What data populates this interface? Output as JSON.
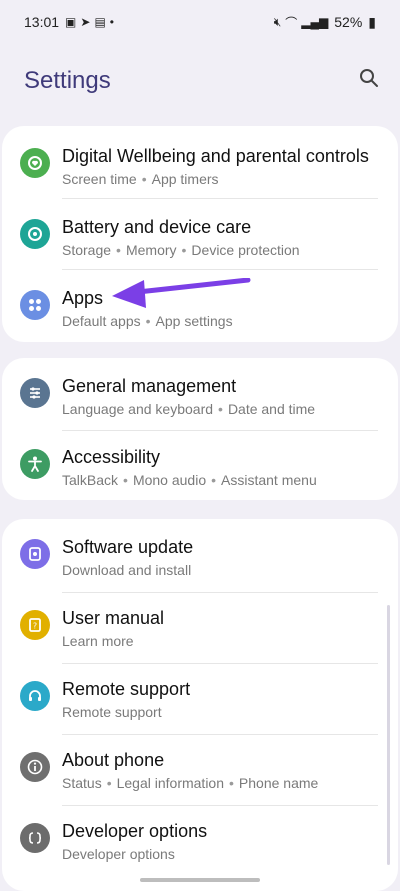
{
  "status_bar": {
    "time": "13:01",
    "battery": "52%"
  },
  "header": {
    "title": "Settings"
  },
  "card1": [
    {
      "title": "Digital Wellbeing and parental controls",
      "subtitle": [
        "Screen time",
        "App timers"
      ],
      "icon": "digital-wellbeing-icon",
      "color": "#4caf50"
    },
    {
      "title": "Battery and device care",
      "subtitle": [
        "Storage",
        "Memory",
        "Device protection"
      ],
      "icon": "battery-care-icon",
      "color": "#1ea596"
    },
    {
      "title": "Apps",
      "subtitle": [
        "Default apps",
        "App settings"
      ],
      "icon": "apps-icon",
      "color": "#6b8fe3"
    }
  ],
  "card2": [
    {
      "title": "General management",
      "subtitle": [
        "Language and keyboard",
        "Date and time"
      ],
      "icon": "general-management-icon",
      "color": "#5a7591"
    },
    {
      "title": "Accessibility",
      "subtitle": [
        "TalkBack",
        "Mono audio",
        "Assistant menu"
      ],
      "icon": "accessibility-icon",
      "color": "#3d9c63"
    }
  ],
  "card3": [
    {
      "title": "Software update",
      "subtitle": [
        "Download and install"
      ],
      "icon": "software-update-icon",
      "color": "#7d6ee7"
    },
    {
      "title": "User manual",
      "subtitle": [
        "Learn more"
      ],
      "icon": "user-manual-icon",
      "color": "#e1b000"
    },
    {
      "title": "Remote support",
      "subtitle": [
        "Remote support"
      ],
      "icon": "remote-support-icon",
      "color": "#2ba9c9"
    },
    {
      "title": "About phone",
      "subtitle": [
        "Status",
        "Legal information",
        "Phone name"
      ],
      "icon": "about-phone-icon",
      "color": "#6f6f6f"
    },
    {
      "title": "Developer options",
      "subtitle": [
        "Developer options"
      ],
      "icon": "developer-options-icon",
      "color": "#6c6c6c"
    }
  ],
  "colors": {
    "background": "#f1eff6",
    "title": "#3f3a7a",
    "arrow": "#7b3fe6"
  }
}
